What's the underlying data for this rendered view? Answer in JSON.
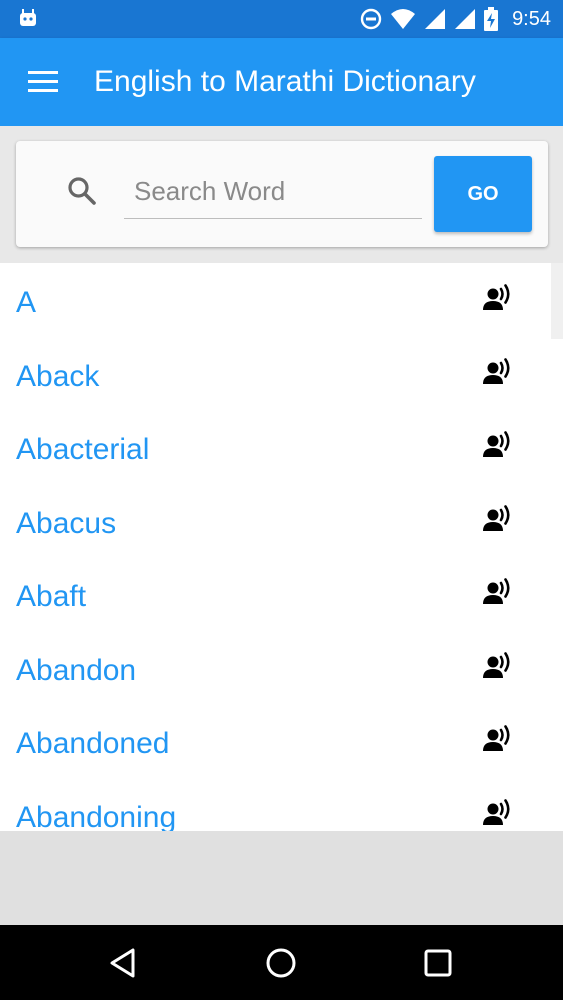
{
  "status_bar": {
    "time": "9:54",
    "icons": [
      "android-icon",
      "dnd-icon",
      "wifi-icon",
      "cell-signal-icon",
      "cell-signal-icon",
      "battery-charging-icon"
    ]
  },
  "app_bar": {
    "title": "English to Marathi Dictionary",
    "menu_icon": "hamburger-menu-icon"
  },
  "search": {
    "placeholder": "Search Word",
    "value": "",
    "go_label": "GO",
    "icon": "search-icon"
  },
  "word_list": {
    "items": [
      {
        "word": "A"
      },
      {
        "word": "Aback"
      },
      {
        "word": "Abacterial"
      },
      {
        "word": "Abacus"
      },
      {
        "word": "Abaft"
      },
      {
        "word": "Abandon"
      },
      {
        "word": "Abandoned"
      },
      {
        "word": "Abandoning"
      }
    ],
    "item_icon": "record-voice-icon"
  },
  "nav_bar": {
    "icons": [
      "back-icon",
      "home-icon",
      "recents-icon"
    ]
  },
  "colors": {
    "primary": "#2196f3",
    "primary_dark": "#1976d2",
    "word_text": "#2196f3"
  }
}
